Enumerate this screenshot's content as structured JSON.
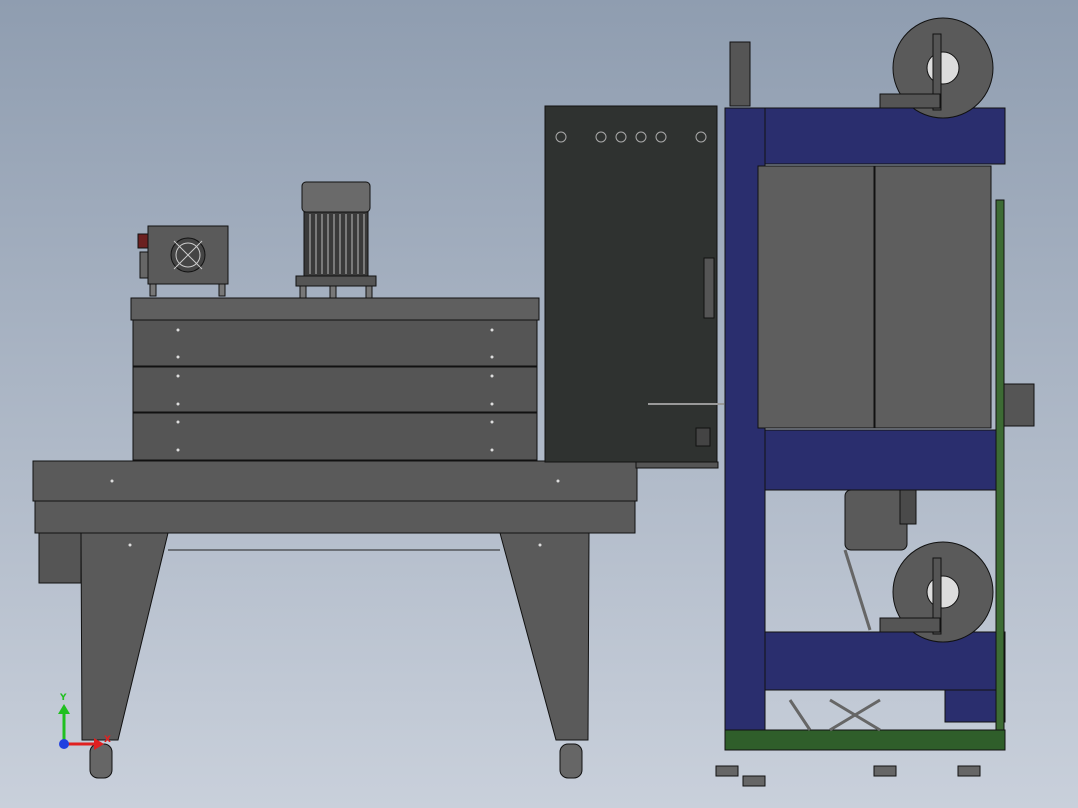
{
  "view": {
    "background_top": "#8f9db0",
    "background_bottom": "#c9d0db"
  },
  "colors": {
    "tunnel_body": "#555555",
    "tunnel_top": "#5f5f5f",
    "stand": "#5a5a5a",
    "cabinet": "#2f3230",
    "frame_blue": "#2a2e6e",
    "panel_gray": "#5e5e5e",
    "base_green": "#2f5e2a",
    "rail_green": "#3d6b34",
    "outline": "#111111"
  },
  "triad": {
    "axis_y_label": "Y",
    "axis_x_label": "X",
    "y_color": "#20c020",
    "x_color": "#e02020",
    "origin_color": "#2040e0"
  },
  "components": {
    "fan_box": "fan-box",
    "motor": "motor",
    "tunnel": "heat-shrink-tunnel",
    "stand": "tunnel-stand",
    "cabinet": "electrical-cabinet",
    "sealer_frame": "sealer-frame",
    "film_roll_top": "film-roll",
    "film_roll_bottom": "film-roll"
  }
}
